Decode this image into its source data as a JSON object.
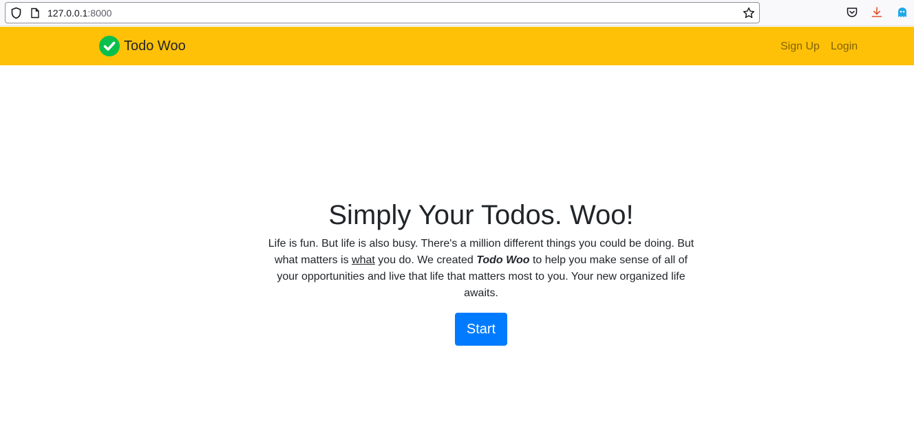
{
  "browser": {
    "url_host": "127.0.0.1",
    "url_port": ":8000",
    "icons": [
      "shield-icon",
      "page-icon",
      "star-icon",
      "pocket-icon",
      "download-icon",
      "ghost-extension-icon"
    ]
  },
  "navbar": {
    "brand": "Todo Woo",
    "links": [
      "Sign Up",
      "Login"
    ],
    "background": "#ffc107"
  },
  "hero": {
    "title": "Simply Your Todos. Woo!",
    "text_part1": "Life is fun. But life is also busy. There's a million different things you could be doing. But what matters is ",
    "text_underlined": "what",
    "text_part2": " you do. We created ",
    "text_bold_italic": "Todo Woo",
    "text_part3": " to help you make sense of all of your opportunities and live that life that matters most to you. Your new organized life awaits.",
    "button": "Start",
    "button_color": "#007bff"
  }
}
